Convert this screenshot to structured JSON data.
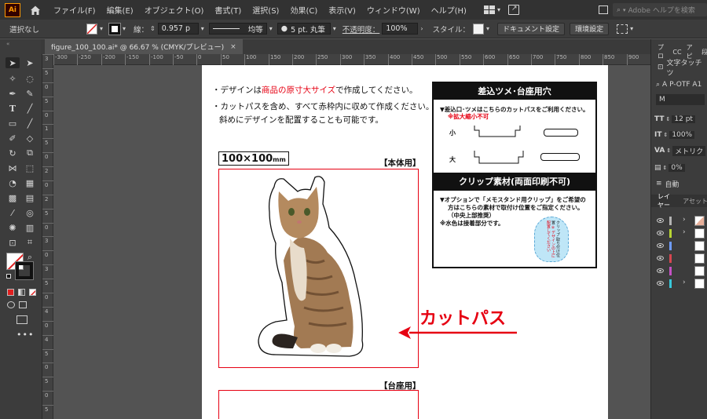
{
  "app": {
    "logo": "Ai"
  },
  "menu": [
    "ファイル(F)",
    "編集(E)",
    "オブジェクト(O)",
    "書式(T)",
    "選択(S)",
    "効果(C)",
    "表示(V)",
    "ウィンドウ(W)",
    "ヘルプ(H)"
  ],
  "help_search": {
    "placeholder": "Adobe ヘルプを検索"
  },
  "control": {
    "selection": "選択なし",
    "stroke_label": "線：",
    "stroke_value": "0.957 p",
    "profile": "均等",
    "brush": "5 pt. 丸筆",
    "opacity_label": "不透明度：",
    "opacity_value": "100%",
    "style_label": "スタイル：",
    "doc_settings": "ドキュメント設定",
    "preferences": "環境設定"
  },
  "tab": {
    "title": "figure_100_100.ai* @ 66.67 % (CMYK/プレビュー)",
    "close": "×"
  },
  "rulers": {
    "top": [
      "-300",
      "-250",
      "-200",
      "-150",
      "-100",
      "-50",
      "0",
      "50",
      "100",
      "150",
      "200",
      "250",
      "300",
      "350",
      "400",
      "450",
      "500",
      "550",
      "600",
      "650",
      "700",
      "750",
      "800",
      "850",
      "900"
    ],
    "left": [
      "3",
      "5",
      "0",
      "5",
      "0",
      "1",
      "5",
      "0",
      "2",
      "0",
      "2",
      "5",
      "0",
      "3",
      "0",
      "3",
      "5",
      "0",
      "4",
      "0",
      "4",
      "5",
      "0",
      "5",
      "0",
      "5"
    ]
  },
  "artboard": {
    "note1_pre": "・デザインは",
    "note1_red": "商品の原寸大サイズ",
    "note1_post": "で作成してください。",
    "note2": "・カットパスを含め、すべて赤枠内に収めて作成ください。",
    "note3": "斜めにデザインを配置することも可能です。",
    "size_label": "100×100",
    "size_unit": "mm",
    "body_label": "【本体用】",
    "base_label": "【台座用】",
    "cutpath_label": "カットパス",
    "info_box": {
      "title1": "差込ツメ･台座用穴",
      "line1": "▼差込口･ツメはこちらのカットパスをご利用ください。",
      "line1_red": "※拡大縮小不可",
      "small": "小",
      "large": "大",
      "title2": "クリップ素材(両面印刷不可)",
      "clip_l1": "▼オプションで「メモスタンド用クリップ」をご希望の",
      "clip_l2": "方はこちらの素材で取付け位置をご指定ください。",
      "clip_l3": "（中央上部推奨）",
      "clip_l4": "※水色は接着部分です。",
      "clip_vertical": "クリップ",
      "clip_vertical2": "取り付け位置",
      "clip_vertical3": "※デザインの上に配置してください"
    }
  },
  "right_panel": {
    "tabs": [
      "プロ",
      "CC",
      "アピ",
      "段"
    ],
    "char_touch": "文字タッチツ",
    "font": "A P-OTF A1",
    "font_style": "M",
    "size": "12 pt",
    "scale": "100%",
    "kerning": "メトリク",
    "tracking": "0%",
    "auto": "自動",
    "layers_tab": "レイヤー",
    "assets_tab": "アセット",
    "layer_colors": [
      "#b3b3b3",
      "#b7d433",
      "#6e9bff",
      "#d64650",
      "#c451c4",
      "#38c7d9"
    ]
  }
}
